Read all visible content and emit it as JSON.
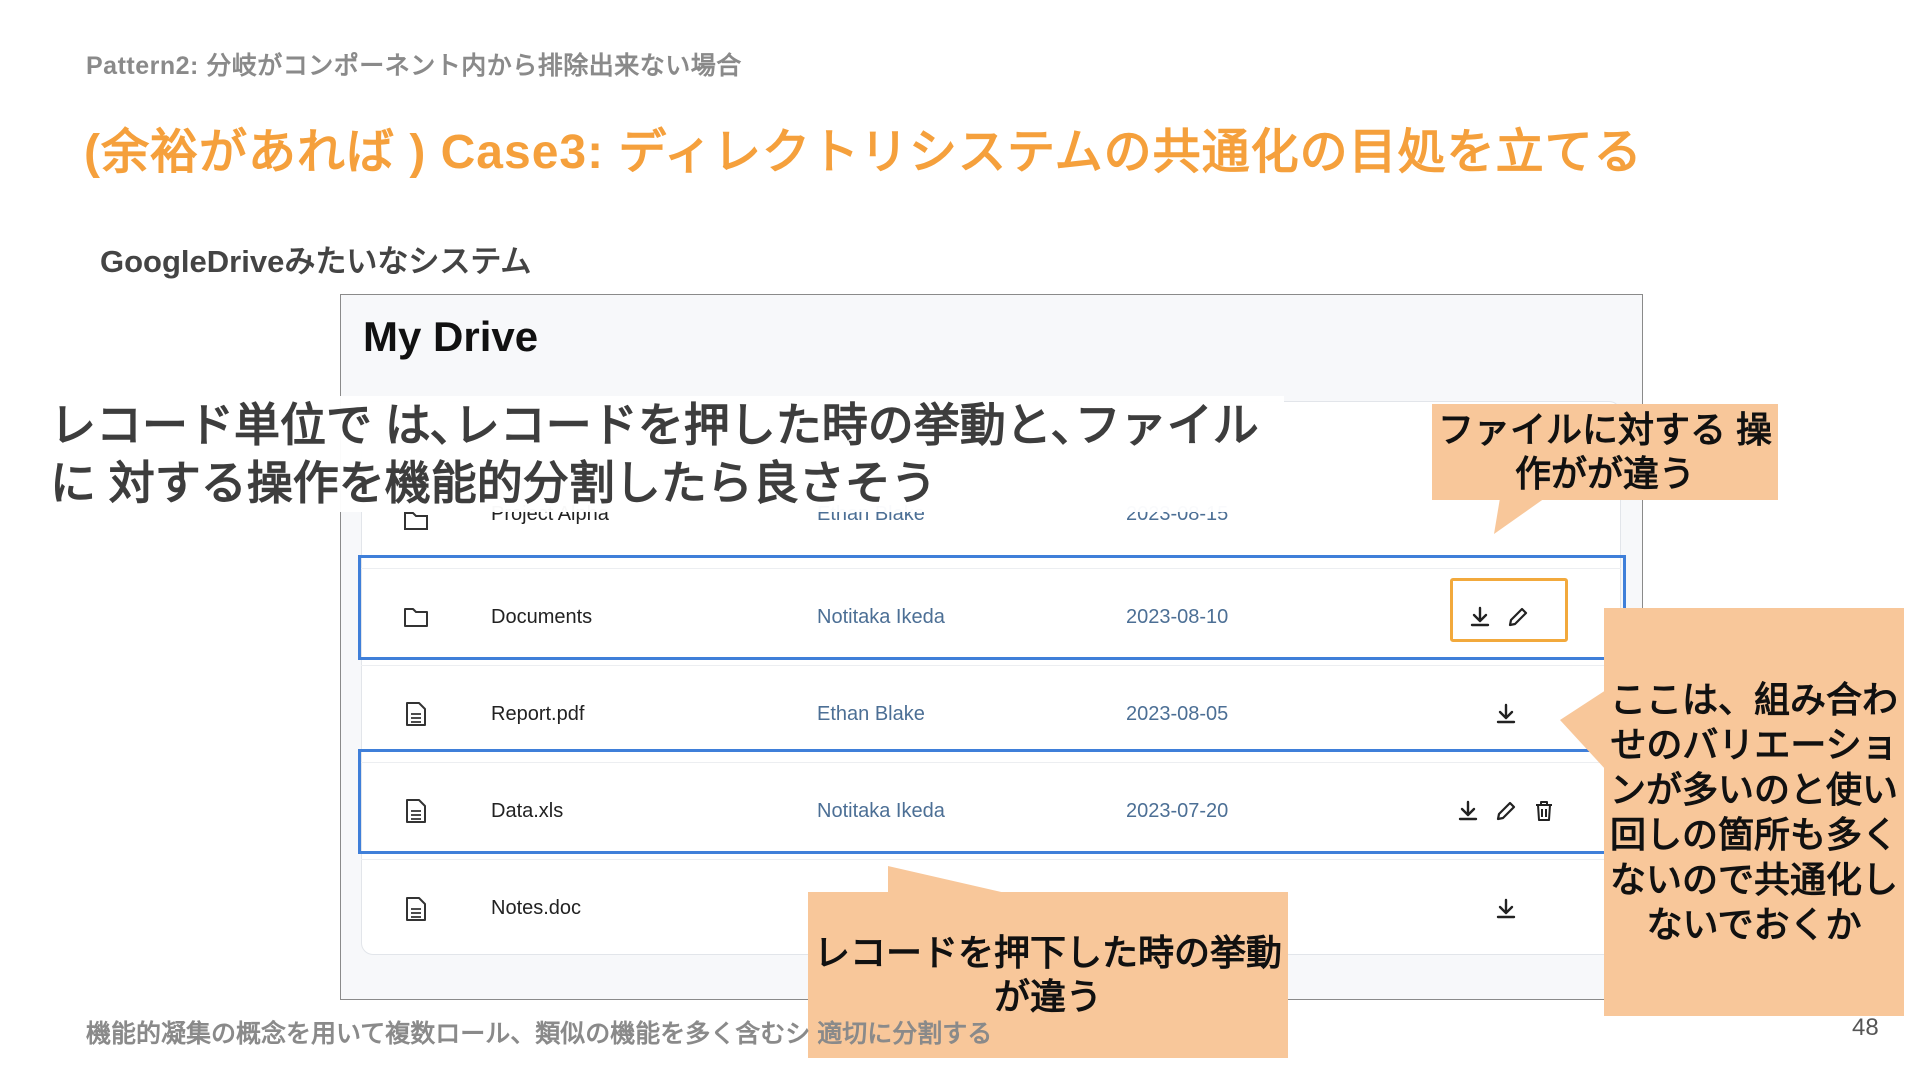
{
  "slide": {
    "pattern_label": "Pattern2: 分岐がコンポーネント内から排除出来ない場合",
    "title": "(余裕があれば ) Case3: ディレクトリシステムの共通化の目処を立てる",
    "subtitle": "GoogleDriveみたいなシステム",
    "overlay_text": "レコード単位で は､レコードを押した時の挙動と､ファイルに 対する操作を機能的分割したら良さそう",
    "bottom_note": "機能的凝集の概念を用いて複数ロール、類似の機能を多く含むシ                                                        適切に分割する",
    "page_number": "48"
  },
  "drive": {
    "title": "My Drive",
    "rows": [
      {
        "name": "Project Alpha",
        "owner": "Ethan Blake",
        "date": "2023-08-15",
        "icon": "folder-icon",
        "actions": []
      },
      {
        "name": "Documents",
        "owner": "Notitaka Ikeda",
        "date": "2023-08-10",
        "icon": "folder-icon",
        "actions": [
          "download-icon",
          "edit-icon"
        ]
      },
      {
        "name": "Report.pdf",
        "owner": "Ethan Blake",
        "date": "2023-08-05",
        "icon": "file-icon",
        "actions": [
          "download-icon"
        ]
      },
      {
        "name": "Data.xls",
        "owner": "Notitaka Ikeda",
        "date": "2023-07-20",
        "icon": "file-icon",
        "actions": [
          "download-icon",
          "edit-icon",
          "delete-icon"
        ]
      },
      {
        "name": "Notes.doc",
        "owner": "",
        "date": "",
        "icon": "file-icon",
        "actions": [
          "download-icon"
        ]
      }
    ]
  },
  "callouts": {
    "top": "ファイルに対する 操作がが違う",
    "right": "ここは、組み合わせのバリエーションが多いのと使い回しの箇所も多くないので共通化しないでおくか",
    "bottom": "レコードを押下した時の挙動が違う"
  },
  "colors": {
    "title": "#f5a03c",
    "highlight": "#3f7fd9",
    "callout": "#f8c79a",
    "action_box": "#f2a93c",
    "link": "#4c6f95"
  }
}
